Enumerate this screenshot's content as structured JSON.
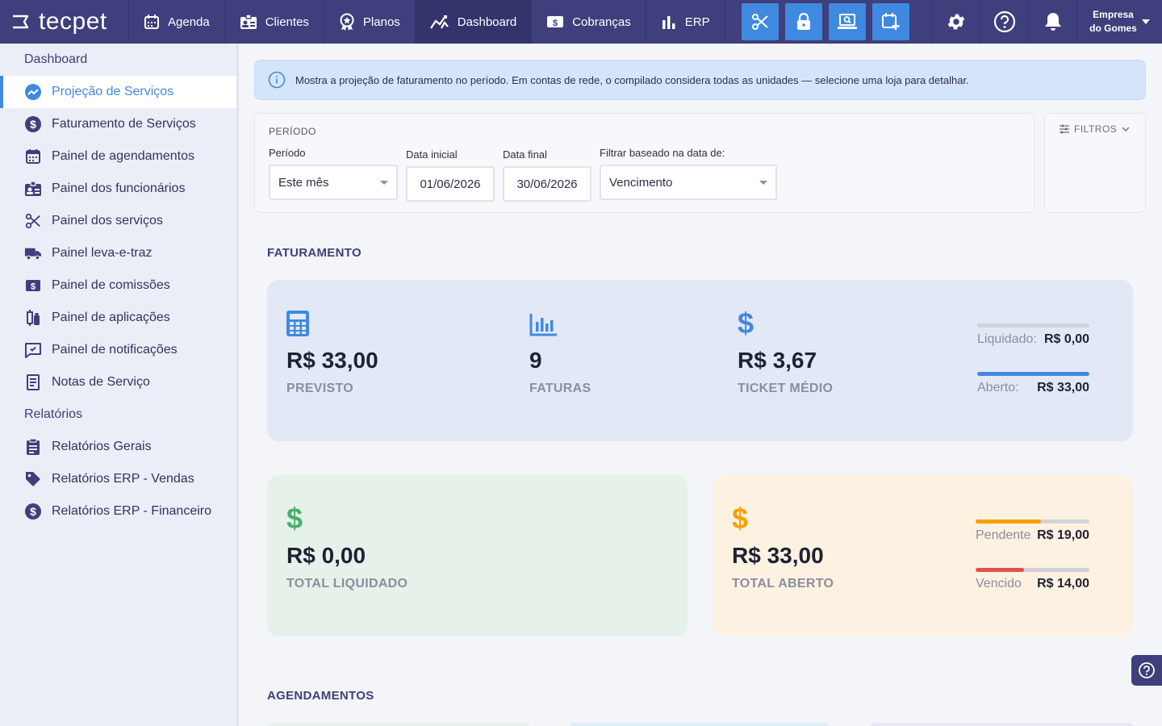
{
  "app": {
    "logo_text": "tecpet"
  },
  "topnav": {
    "items": [
      {
        "label": "Agenda"
      },
      {
        "label": "Clientes"
      },
      {
        "label": "Planos"
      },
      {
        "label": "Dashboard"
      },
      {
        "label": "Cobranças"
      },
      {
        "label": "ERP"
      }
    ],
    "active": "Dashboard",
    "company_line1": "Empresa",
    "company_line2": "do Gomes"
  },
  "sidebar": {
    "section_dashboard": "Dashboard",
    "items": [
      {
        "label": "Projeção de Serviços",
        "icon": "chart-line-icon"
      },
      {
        "label": "Faturamento de Serviços",
        "icon": "dollar-circle-icon"
      },
      {
        "label": "Painel de agendamentos",
        "icon": "calendar-icon"
      },
      {
        "label": "Painel dos funcionários",
        "icon": "badge-icon"
      },
      {
        "label": "Painel dos serviços",
        "icon": "scissors-icon"
      },
      {
        "label": "Painel leva-e-traz",
        "icon": "truck-icon"
      },
      {
        "label": "Painel de comissões",
        "icon": "money-icon"
      },
      {
        "label": "Painel de aplicações",
        "icon": "syringe-icon"
      },
      {
        "label": "Painel de notificações",
        "icon": "notification-icon"
      },
      {
        "label": "Notas de Serviço",
        "icon": "receipt-icon"
      }
    ],
    "section_reports": "Relatórios",
    "report_items": [
      {
        "label": "Relatórios Gerais",
        "icon": "clipboard-icon"
      },
      {
        "label": "Relatórios ERP - Vendas",
        "icon": "tag-icon"
      },
      {
        "label": "Relatórios ERP - Financeiro",
        "icon": "dollar-circle-icon"
      }
    ]
  },
  "info_banner": "Mostra a projeção de faturamento no período. Em contas de rede, o compilado considera todas as unidades — selecione uma loja para detalhar.",
  "period": {
    "title": "PERÍODO",
    "period_label": "Período",
    "period_value": "Este mês",
    "start_label": "Data inicial",
    "start_value": "01/06/2026",
    "end_label": "Data final",
    "end_value": "30/06/2026",
    "filter_by_label": "Filtrar baseado na data de:",
    "filter_by_value": "Vencimento"
  },
  "filters_button": "FILTROS",
  "faturamento": {
    "title": "FATURAMENTO",
    "previsto_value": "R$ 33,00",
    "previsto_label": "PREVISTO",
    "faturas_value": "9",
    "faturas_label": "FATURAS",
    "ticket_value": "R$ 3,67",
    "ticket_label": "TICKET MÉDIO",
    "liquidado_label": "Liquidado:",
    "liquidado_value": "R$ 0,00",
    "liquidado_fraction": 0,
    "aberto_label": "Aberto:",
    "aberto_value": "R$ 33,00",
    "aberto_fraction": 1
  },
  "total_liquidado": {
    "value": "R$ 0,00",
    "label": "TOTAL LIQUIDADO"
  },
  "total_aberto": {
    "value": "R$ 33,00",
    "label": "TOTAL ABERTO",
    "pendente_label": "Pendente",
    "pendente_value": "R$ 19,00",
    "pendente_fraction": 0.576,
    "vencido_label": "Vencido",
    "vencido_value": "R$ 14,00",
    "vencido_fraction": 0.424
  },
  "agendamentos_title": "AGENDAMENTOS",
  "colors": {
    "nav_bg": "#3e3f7c",
    "accent_blue": "#3f8ae0",
    "green": "#4caf6a",
    "orange": "#f5a200",
    "red": "#e05050"
  }
}
